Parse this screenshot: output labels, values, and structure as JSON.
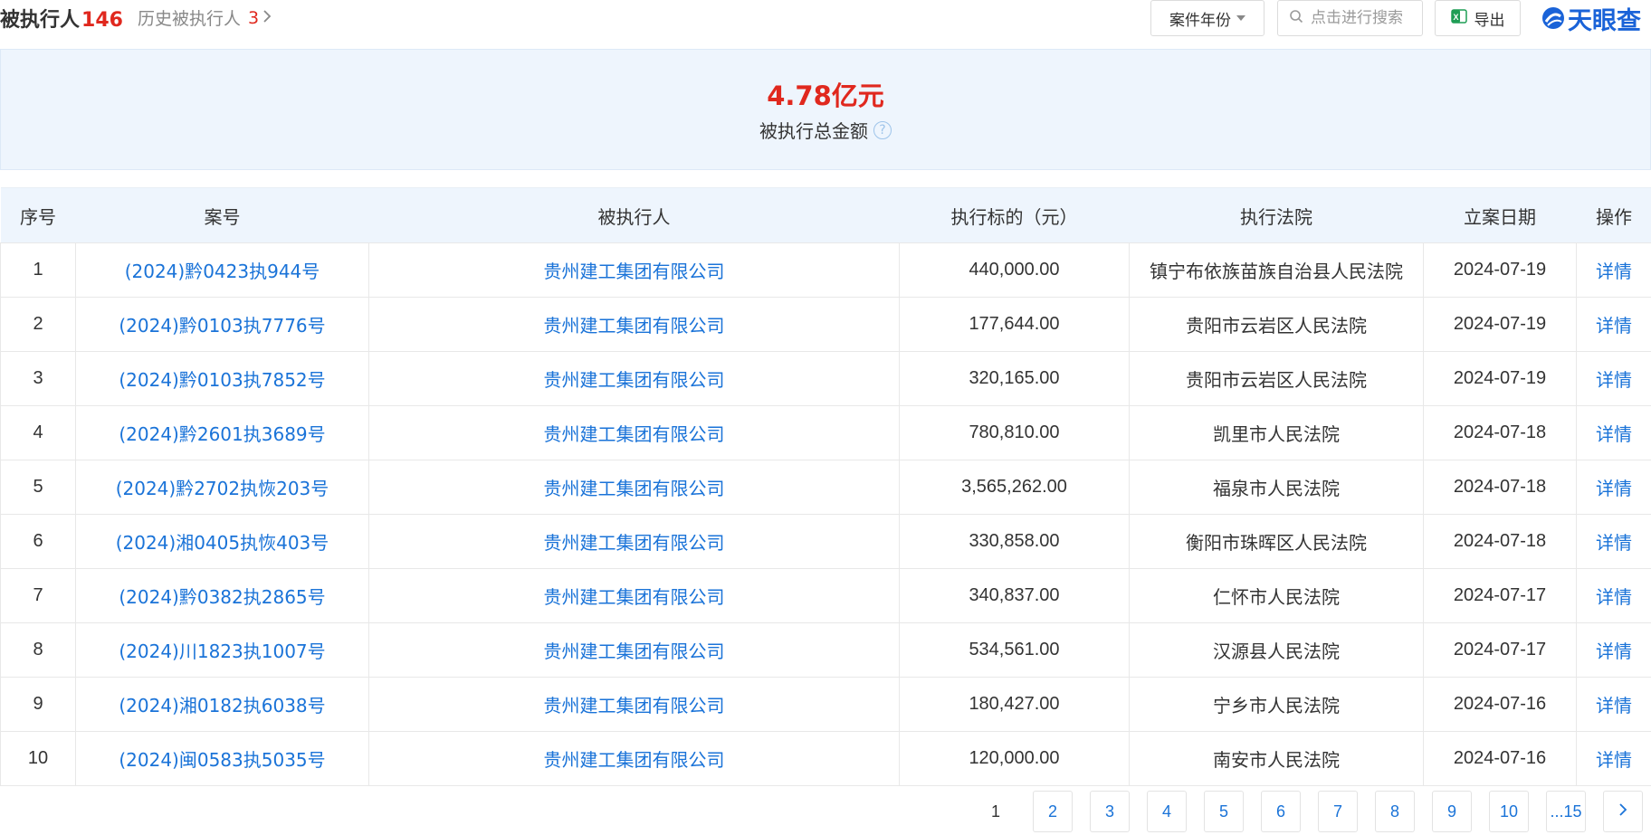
{
  "header": {
    "title": "被执行人",
    "count": "146",
    "history_label": "历史被执行人",
    "history_count": "3",
    "year_filter_label": "案件年份",
    "search_placeholder": "点击进行搜索",
    "export_label": "导出",
    "brand_name": "天眼查"
  },
  "summary": {
    "amount": "4.78亿元",
    "label": "被执行总金额",
    "help": "?"
  },
  "table": {
    "columns": [
      "序号",
      "案号",
      "被执行人",
      "执行标的（元）",
      "执行法院",
      "立案日期",
      "操作"
    ],
    "rows": [
      {
        "no": "1",
        "case_no": "(2024)黔0423执944号",
        "party": "贵州建工集团有限公司",
        "amount": "440,000.00",
        "court": "镇宁布依族苗族自治县人民法院",
        "date": "2024-07-19",
        "action": "详情"
      },
      {
        "no": "2",
        "case_no": "(2024)黔0103执7776号",
        "party": "贵州建工集团有限公司",
        "amount": "177,644.00",
        "court": "贵阳市云岩区人民法院",
        "date": "2024-07-19",
        "action": "详情"
      },
      {
        "no": "3",
        "case_no": "(2024)黔0103执7852号",
        "party": "贵州建工集团有限公司",
        "amount": "320,165.00",
        "court": "贵阳市云岩区人民法院",
        "date": "2024-07-19",
        "action": "详情"
      },
      {
        "no": "4",
        "case_no": "(2024)黔2601执3689号",
        "party": "贵州建工集团有限公司",
        "amount": "780,810.00",
        "court": "凯里市人民法院",
        "date": "2024-07-18",
        "action": "详情"
      },
      {
        "no": "5",
        "case_no": "(2024)黔2702执恢203号",
        "party": "贵州建工集团有限公司",
        "amount": "3,565,262.00",
        "court": "福泉市人民法院",
        "date": "2024-07-18",
        "action": "详情"
      },
      {
        "no": "6",
        "case_no": "(2024)湘0405执恢403号",
        "party": "贵州建工集团有限公司",
        "amount": "330,858.00",
        "court": "衡阳市珠晖区人民法院",
        "date": "2024-07-18",
        "action": "详情"
      },
      {
        "no": "7",
        "case_no": "(2024)黔0382执2865号",
        "party": "贵州建工集团有限公司",
        "amount": "340,837.00",
        "court": "仁怀市人民法院",
        "date": "2024-07-17",
        "action": "详情"
      },
      {
        "no": "8",
        "case_no": "(2024)川1823执1007号",
        "party": "贵州建工集团有限公司",
        "amount": "534,561.00",
        "court": "汉源县人民法院",
        "date": "2024-07-17",
        "action": "详情"
      },
      {
        "no": "9",
        "case_no": "(2024)湘0182执6038号",
        "party": "贵州建工集团有限公司",
        "amount": "180,427.00",
        "court": "宁乡市人民法院",
        "date": "2024-07-16",
        "action": "详情"
      },
      {
        "no": "10",
        "case_no": "(2024)闽0583执5035号",
        "party": "贵州建工集团有限公司",
        "amount": "120,000.00",
        "court": "南安市人民法院",
        "date": "2024-07-16",
        "action": "详情"
      }
    ]
  },
  "pagination": {
    "current": "1",
    "pages": [
      "2",
      "3",
      "4",
      "5",
      "6",
      "7",
      "8",
      "9",
      "10",
      "...15"
    ],
    "next_icon": "chevron-right-icon"
  },
  "colors": {
    "accent_red": "#e0281e",
    "link_blue": "#1a73d8",
    "header_bg": "#eef5fd",
    "brand_blue": "#1a63d8"
  }
}
